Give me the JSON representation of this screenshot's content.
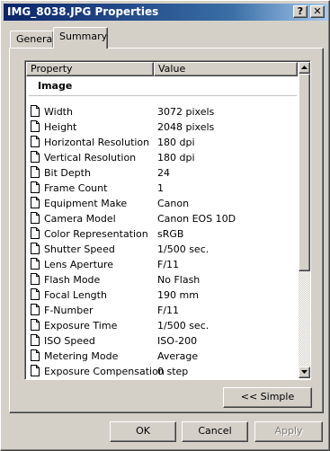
{
  "window": {
    "title": "IMG_8038.JPG Properties",
    "help_label": "?",
    "close_label": "✕"
  },
  "tabs": [
    {
      "label": "General",
      "selected": false
    },
    {
      "label": "Summary",
      "selected": true
    }
  ],
  "list": {
    "columns": {
      "property": "Property",
      "value": "Value"
    },
    "group": "Image",
    "rows": [
      {
        "property": "Width",
        "value": "3072 pixels"
      },
      {
        "property": "Height",
        "value": "2048 pixels"
      },
      {
        "property": "Horizontal Resolution",
        "value": "180 dpi"
      },
      {
        "property": "Vertical Resolution",
        "value": "180 dpi"
      },
      {
        "property": "Bit Depth",
        "value": "24"
      },
      {
        "property": "Frame Count",
        "value": "1"
      },
      {
        "property": "Equipment Make",
        "value": "Canon"
      },
      {
        "property": "Camera Model",
        "value": "Canon EOS 10D"
      },
      {
        "property": "Color Representation",
        "value": "sRGB"
      },
      {
        "property": "Shutter Speed",
        "value": "1/500 sec."
      },
      {
        "property": "Lens Aperture",
        "value": "F/11"
      },
      {
        "property": "Flash Mode",
        "value": "No Flash"
      },
      {
        "property": "Focal Length",
        "value": "190 mm"
      },
      {
        "property": "F-Number",
        "value": "F/11"
      },
      {
        "property": "Exposure Time",
        "value": "1/500 sec."
      },
      {
        "property": "ISO Speed",
        "value": "ISO-200"
      },
      {
        "property": "Metering Mode",
        "value": "Average"
      },
      {
        "property": "Exposure Compensation",
        "value": "0 step"
      }
    ]
  },
  "buttons": {
    "simple": "<< Simple",
    "ok": "OK",
    "cancel": "Cancel",
    "apply": "Apply"
  },
  "colors": {
    "titlebar_start": "#0a246a",
    "titlebar_end": "#a6caf0",
    "face": "#d4d0c8"
  }
}
